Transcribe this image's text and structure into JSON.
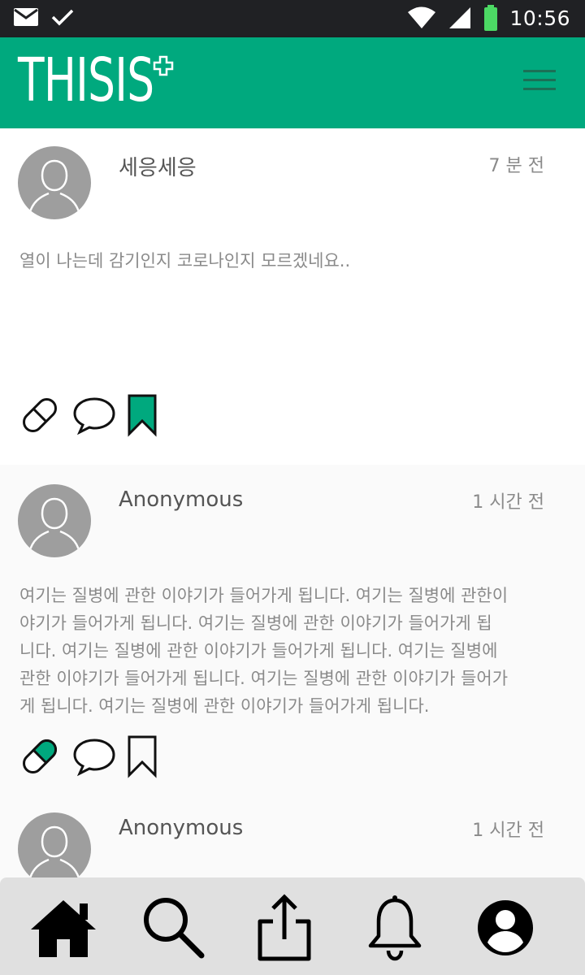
{
  "status_bar": {
    "time": "10:56",
    "icons": [
      "mail-icon",
      "check-icon",
      "wifi-icon",
      "signal-icon",
      "battery-icon"
    ]
  },
  "app": {
    "logo": "THISIS",
    "accent_color": "#00a97e"
  },
  "posts": [
    {
      "author": "세응세응",
      "time": "7 분 전",
      "body": "열이 나는데 감기인지 코로나인지 모르겠네요..",
      "pill_active": false,
      "bookmarked": true
    },
    {
      "author": "Anonymous",
      "time": "1 시간 전",
      "body_lines": [
        "여기는 질병에 관한 이야기가 들어가게 됩니다. 여기는 질병에 관한이",
        "야기가 들어가게 됩니다.  여기는 질병에 관한 이야기가 들어가게 됩",
        "니다.  여기는 질병에 관한 이야기가 들어가게 됩니다. 여기는 질병에",
        "관한 이야기가 들어가게 됩니다. 여기는 질병에 관한 이야기가 들어가",
        "게 됩니다. 여기는 질병에 관한 이야기가 들어가게 됩니다."
      ],
      "pill_active": true,
      "bookmarked": false
    },
    {
      "author": "Anonymous",
      "time": "1 시간 전"
    }
  ],
  "bottom_nav": [
    "home-icon",
    "search-icon",
    "share-icon",
    "bell-icon",
    "profile-icon"
  ]
}
